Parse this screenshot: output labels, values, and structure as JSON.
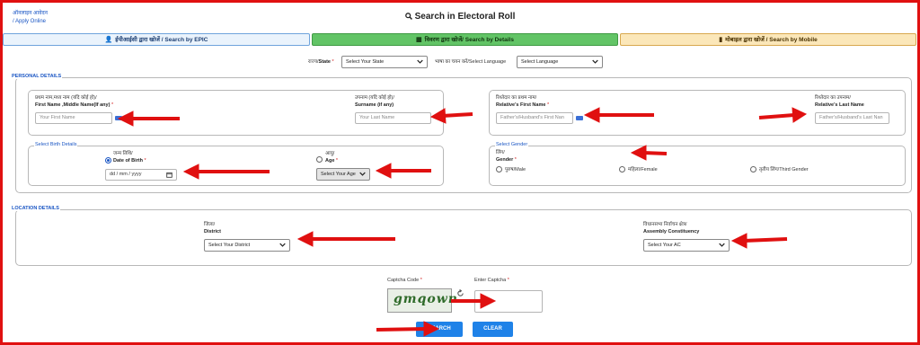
{
  "header": {
    "link_hindi": "ऑनलाइन आवेदन",
    "link_english": "/ Apply Online",
    "title": "Search in Electoral Roll"
  },
  "tabs": [
    {
      "label": "ईपीआईसी द्वारा खोजें / Search by EPIC",
      "icon": "person-icon"
    },
    {
      "label": "विवरण द्वारा खोजें/ Search by Details",
      "icon": "details-icon"
    },
    {
      "label": "मोबाइल द्वारा खोजें / Search by Mobile",
      "icon": "mobile-icon"
    }
  ],
  "filters": {
    "state_hindi": "राज्य/",
    "state_label": "State",
    "state_required": "*",
    "state_value": "Select Your State",
    "language_label": "भाषा का चयन करें/Select Language",
    "language_value": "Select Language"
  },
  "personal": {
    "legend": "PERSONAL DETAILS",
    "first_name_hindi": "प्रथम नाम,मध्य नाम (यदि कोई हो)/",
    "first_name_label": "First Name ,Middle Name(If any)",
    "first_name_placeholder": "Your First Name",
    "surname_hindi": "उपनाम (यदि कोई हो)/",
    "surname_label": "Surname (if any)",
    "surname_placeholder": "Your Last Name",
    "rel_first_hindi": "रिश्तेदार का प्रथम नाम/",
    "rel_first_label": "Relative's First Name",
    "rel_first_placeholder": "Father's/Husband's First Nan",
    "rel_last_hindi": "रिश्तेदार का उपनाम/",
    "rel_last_label": "Relative's Last Name",
    "rel_last_placeholder": "Father's/Husband's Last Nan",
    "birth_legend": "Select Birth Details",
    "dob_hindi": "जन्म तिथि/",
    "dob_label": "Date of Birth",
    "dob_placeholder": "dd / mm / yyyy",
    "age_hindi": "आयु/",
    "age_label": "Age",
    "age_value": "Select Your Age",
    "gender_legend": "Select Gender",
    "gender_hindi": "लिंग/",
    "gender_label": "Gender",
    "gender_male": "पुरुष/Male",
    "gender_female": "महिला/Female",
    "gender_third": "तृतीय लिंग/Third Gender",
    "required_mark": "*"
  },
  "location": {
    "legend": "LOCATION DETAILS",
    "district_hindi": "जिला/",
    "district_label": "District",
    "district_value": "Select Your District",
    "ac_hindi": "विधानसभा निर्वाचन क्षेत्र/",
    "ac_label": "Assembly Constituency",
    "ac_value": "Select Your AC"
  },
  "captcha": {
    "code_label": "Captcha Code",
    "enter_label": "Enter Captcha",
    "required_mark": "*",
    "code_text": "gmqown"
  },
  "actions": {
    "search": "SEARCH",
    "clear": "CLEAR"
  },
  "colors": {
    "frame": "#e01010",
    "accent": "#1a56c4",
    "button": "#1f82e8",
    "tab_active": "#62c466",
    "arrow": "#e01010"
  }
}
